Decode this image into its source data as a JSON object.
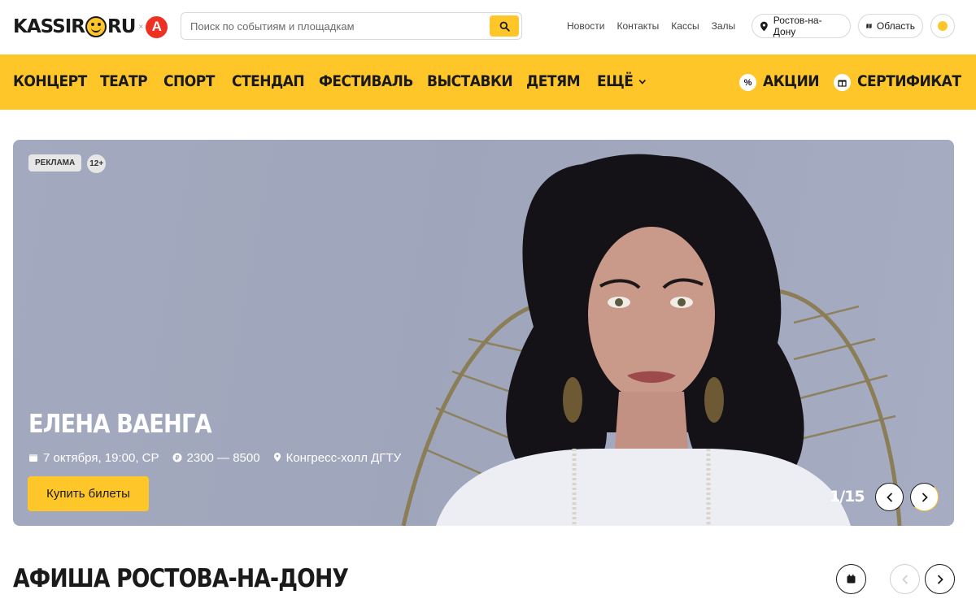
{
  "brand": {
    "logo_left": "KASSIR",
    "logo_right": "RU",
    "partner_letter": "А"
  },
  "search": {
    "placeholder": "Поиск по событиям и площадкам"
  },
  "top_links": [
    "Новости",
    "Контакты",
    "Кассы",
    "Залы"
  ],
  "city": {
    "label": "Ростов-на-Дону"
  },
  "region": {
    "label": "Область"
  },
  "nav": {
    "items": [
      "КОНЦЕРТ",
      "ТЕАТР",
      "СПОРТ",
      "СТЕНДАП",
      "ФЕСТИВАЛЬ",
      "ВЫСТАВКИ",
      "ДЕТЯМ",
      "ЕЩЁ"
    ],
    "promo": {
      "label": "АКЦИИ",
      "badge": "%"
    },
    "certificate": {
      "label": "СЕРТИФИКАТ"
    }
  },
  "hero": {
    "ad_label": "РЕКЛАМА",
    "age": "12+",
    "title": "ЕЛЕНА ВАЕНГА",
    "date": "7 октября, 19:00, СР",
    "price": "2300 — 8500",
    "venue": "Конгресс-холл ДГТУ",
    "buy_label": "Купить билеты",
    "counter": "1/15"
  },
  "section": {
    "title": "АФИША РОСТОВА-НА-ДОНУ"
  },
  "colors": {
    "accent": "#ffc629",
    "hero_bg": "#a3a9be",
    "dark": "#1a1a1a"
  }
}
